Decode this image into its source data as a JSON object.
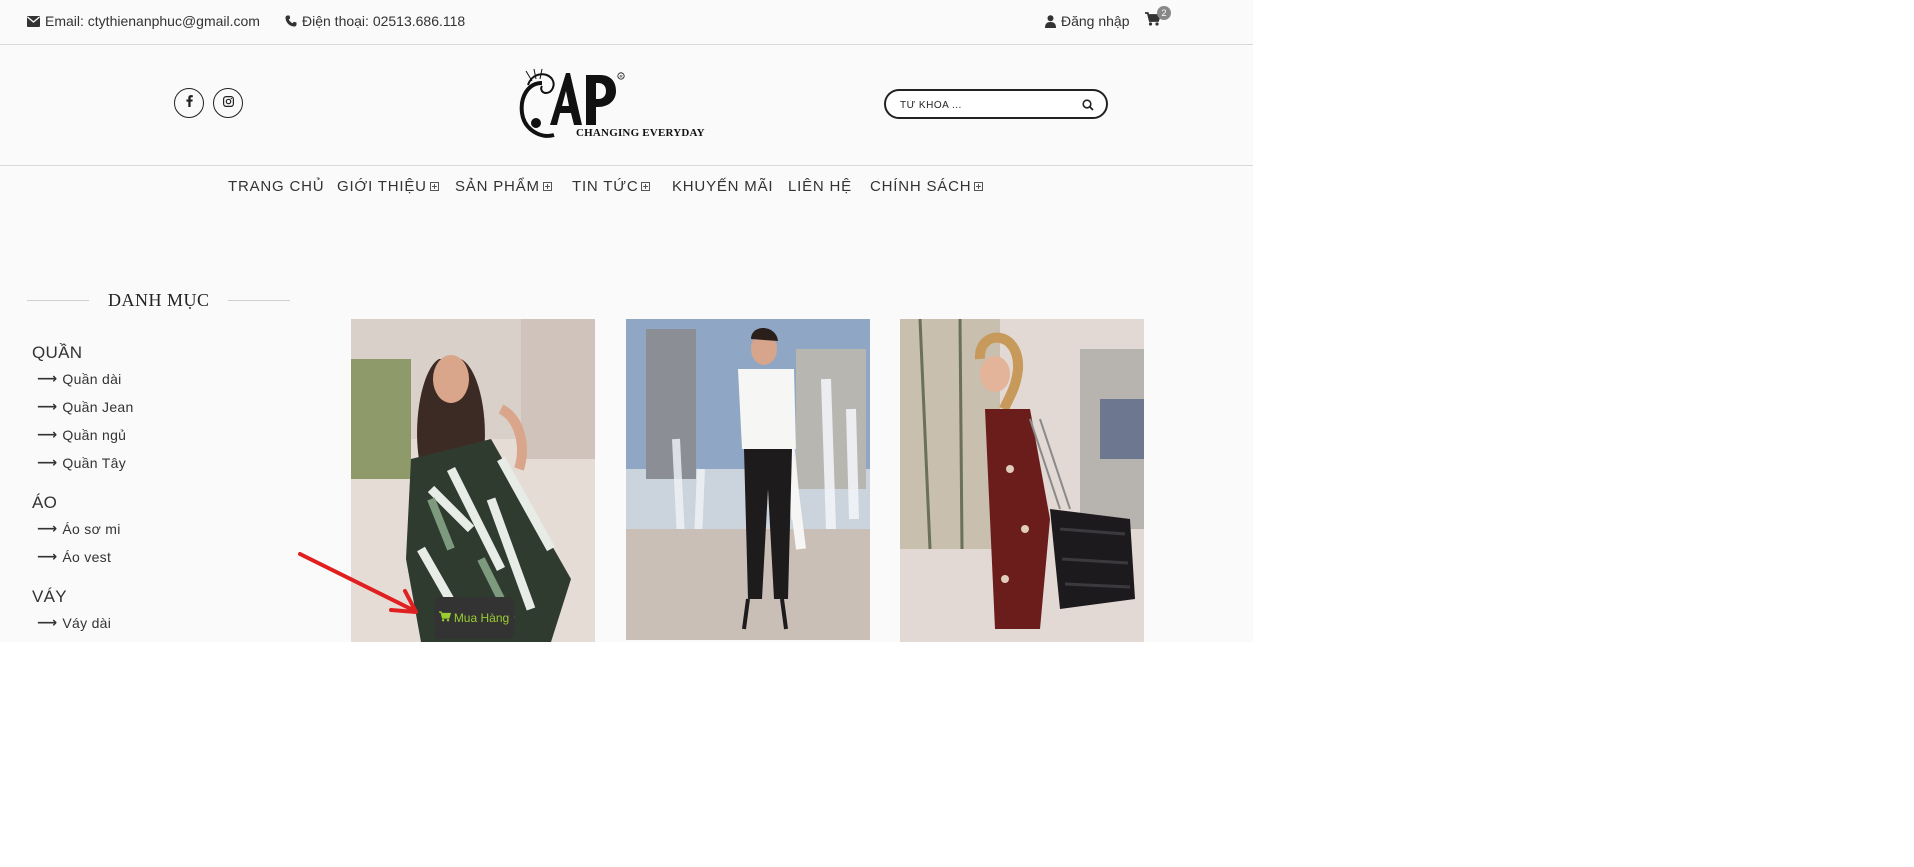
{
  "topbar": {
    "email": "Email: ctythienanphuc@gmail.com",
    "phone": "Điện thoại: 02513.686.118",
    "login": "Đăng nhập",
    "cart_count": "2"
  },
  "header": {
    "logo_tagline": "CHANGING EVERYDAY",
    "search_placeholder": "TỪ KHÓA ..."
  },
  "nav": [
    {
      "label": "TRANG CHỦ",
      "has_submenu": false
    },
    {
      "label": "GIỚI THIỆU",
      "has_submenu": true
    },
    {
      "label": "SẢN PHẨM",
      "has_submenu": true
    },
    {
      "label": "TIN TỨC",
      "has_submenu": true
    },
    {
      "label": "KHUYẾN MÃI",
      "has_submenu": false
    },
    {
      "label": "LIÊN HỆ",
      "has_submenu": false
    },
    {
      "label": "CHÍNH SÁCH",
      "has_submenu": true
    }
  ],
  "sidebar": {
    "title": "DANH MỤC",
    "categories": [
      {
        "name": "QUẦN",
        "items": [
          "Quần dài",
          "Quần Jean",
          "Quần ngủ",
          "Quần Tây"
        ]
      },
      {
        "name": "ÁO",
        "items": [
          "Áo sơ mi",
          "Áo vest"
        ]
      },
      {
        "name": "VÁY",
        "items": [
          "Váy dài"
        ]
      }
    ]
  },
  "product_overlay": {
    "buy_label": "Mua Hàng"
  },
  "colors": {
    "accent_buy": "#9acd32",
    "annotation_arrow": "#e02020"
  }
}
